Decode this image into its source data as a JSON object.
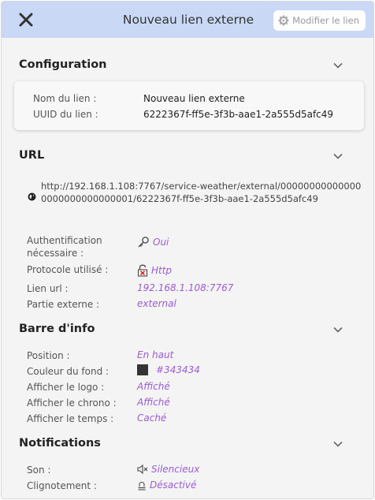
{
  "header": {
    "title": "Nouveau lien externe",
    "edit_label": "Modifier le lien"
  },
  "sections": {
    "configuration": {
      "title": "Configuration",
      "name_label": "Nom du lien :",
      "name_value": "Nouveau lien externe",
      "uuid_label": "UUID du lien :",
      "uuid_value": "6222367f-ff5e-3f3b-aae1-2a555d5afc49"
    },
    "url": {
      "title": "URL",
      "full_url": "http://192.168.1.108:7767/service-weather/external/000000000000000000000000000001/6222367f-ff5e-3f3b-aae1-2a555d5afc49",
      "auth_label": "Authentification nécessaire :",
      "auth_value": "Oui",
      "protocol_label": "Protocole utilisé :",
      "protocol_value": "Http",
      "link_label": "Lien url :",
      "link_value": "192.168.1.108:7767",
      "external_label": "Partie externe :",
      "external_value": "external"
    },
    "info_bar": {
      "title": "Barre d'info",
      "position_label": "Position :",
      "position_value": "En haut",
      "bg_label": "Couleur du fond :",
      "bg_value": "#343434",
      "logo_label": "Afficher le logo :",
      "logo_value": "Affiché",
      "chrono_label": "Afficher le chrono :",
      "chrono_value": "Affiché",
      "time_label": "Afficher le temps :",
      "time_value": "Caché"
    },
    "notifications": {
      "title": "Notifications",
      "sound_label": "Son :",
      "sound_value": "Silencieux",
      "blink_label": "Clignotement :",
      "blink_value": "Désactivé"
    }
  },
  "colors": {
    "header_bg": "#c9d8f5",
    "accent": "#9b5cd4",
    "swatch": "#343434"
  },
  "icons": [
    "close-icon",
    "gear-icon",
    "chevron-down-icon",
    "globe-icon",
    "key-icon",
    "unlock-icon",
    "mute-icon",
    "bell-off-icon"
  ]
}
